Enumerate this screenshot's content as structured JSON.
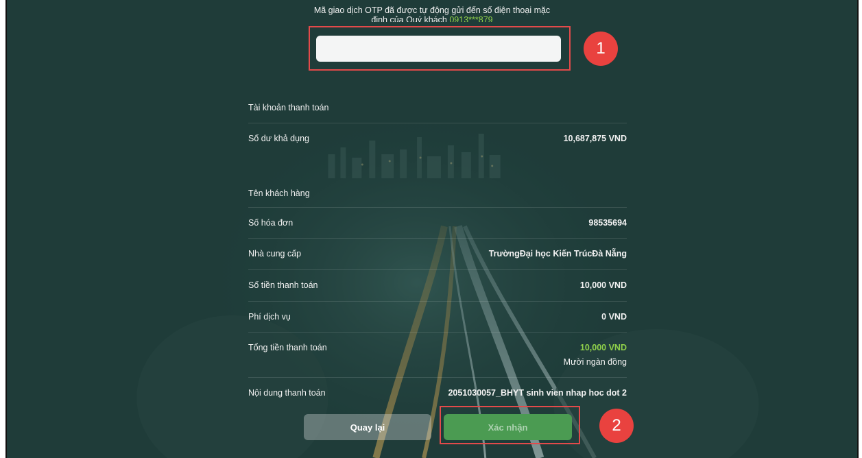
{
  "otp": {
    "message_line1": "Mã giao dịch OTP đã được tự động gửi đến số điện thoại mặc",
    "message_line2_prefix": "định của Quý khách ",
    "phone": "0913***879",
    "input_value": "",
    "input_placeholder": ""
  },
  "details": {
    "account_label": "Tài khoản thanh toán",
    "account_value": "",
    "balance_label": "Số dư khả dụng",
    "balance_value": "10,687,875 VND",
    "customer_label": "Tên khách hàng",
    "customer_value": "",
    "invoice_label": "Số hóa đơn",
    "invoice_value": "98535694",
    "provider_label": "Nhà cung cấp",
    "provider_value": "TrườngĐại học Kiến TrúcĐà Nẵng",
    "amount_label": "Số tiền thanh toán",
    "amount_value": "10,000 VND",
    "fee_label": "Phí dịch vụ",
    "fee_value": "0 VND",
    "total_label": "Tổng tiền thanh toán",
    "total_value": "10,000 VND",
    "total_words": "Mười ngàn đồng",
    "content_label": "Nội dung thanh toán",
    "content_value": "2051030057_BHYT sinh vien nhap hoc dot 2"
  },
  "buttons": {
    "back_label": "Quay lại",
    "confirm_label": "Xác nhận"
  },
  "annotations": {
    "step1": "1",
    "step2": "2"
  },
  "colors": {
    "accent_green": "#8fd04a",
    "highlight_red": "#e34a4a",
    "confirm_green": "#4b9b52"
  }
}
